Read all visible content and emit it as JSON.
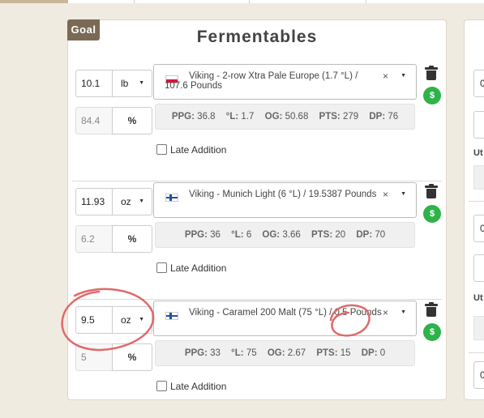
{
  "panel": {
    "badge": "Goal",
    "title": "Fermentables"
  },
  "fermentables": [
    {
      "amount": "10.1",
      "unit": "lb",
      "percent": "84.4",
      "percent_sign": "%",
      "flag": "poland-flag-icon",
      "grain": "Viking - 2-row Xtra Pale Europe (1.7 °L) / 107.6 Pounds",
      "clear": "×",
      "stats": {
        "ppg": "36.8",
        "l": "1.7",
        "og": "50.68",
        "pts": "279",
        "dp": "76"
      },
      "late_label": "Late Addition"
    },
    {
      "amount": "11.93",
      "unit": "oz",
      "percent": "6.2",
      "percent_sign": "%",
      "flag": "finland-flag-icon",
      "grain": "Viking - Munich Light (6 °L) / 19.5387 Pounds",
      "clear": "×",
      "stats": {
        "ppg": "36",
        "l": "6",
        "og": "3.66",
        "pts": "20",
        "dp": "70"
      },
      "late_label": "Late Addition"
    },
    {
      "amount": "9.5",
      "unit": "oz",
      "percent": "5",
      "percent_sign": "%",
      "flag": "finland-flag-icon",
      "grain": "Viking - Caramel 200 Malt (75 °L) / 0.5 Pounds",
      "clear": "×",
      "stats": {
        "ppg": "33",
        "l": "75",
        "og": "2.67",
        "pts": "15",
        "dp": "0"
      },
      "late_label": "Late Addition"
    }
  ],
  "stat_labels": {
    "ppg": "PPG:",
    "l": "°L:",
    "og": "OG:",
    "pts": "PTS:",
    "dp": "DP:"
  },
  "dollar_label": "$",
  "right_panel": {
    "values": [
      "0",
      "0",
      "0"
    ],
    "labels": [
      "Ut",
      "Ut"
    ]
  },
  "colors": {
    "badge": "#7a6a55",
    "dollar": "#2eb34a",
    "annotation": "#e06a6a"
  }
}
